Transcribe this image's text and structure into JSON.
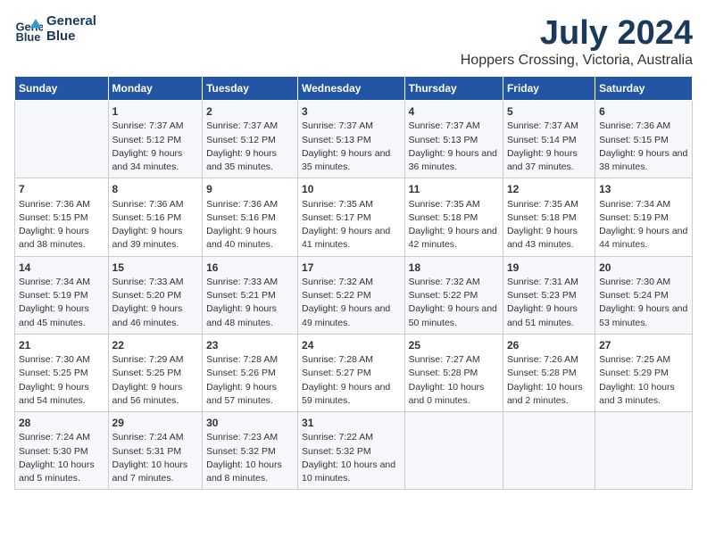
{
  "logo": {
    "line1": "General",
    "line2": "Blue"
  },
  "title": "July 2024",
  "location": "Hoppers Crossing, Victoria, Australia",
  "days_of_week": [
    "Sunday",
    "Monday",
    "Tuesday",
    "Wednesday",
    "Thursday",
    "Friday",
    "Saturday"
  ],
  "weeks": [
    [
      {
        "day": "",
        "sunrise": "",
        "sunset": "",
        "daylight": ""
      },
      {
        "day": "1",
        "sunrise": "Sunrise: 7:37 AM",
        "sunset": "Sunset: 5:12 PM",
        "daylight": "Daylight: 9 hours and 34 minutes."
      },
      {
        "day": "2",
        "sunrise": "Sunrise: 7:37 AM",
        "sunset": "Sunset: 5:12 PM",
        "daylight": "Daylight: 9 hours and 35 minutes."
      },
      {
        "day": "3",
        "sunrise": "Sunrise: 7:37 AM",
        "sunset": "Sunset: 5:13 PM",
        "daylight": "Daylight: 9 hours and 35 minutes."
      },
      {
        "day": "4",
        "sunrise": "Sunrise: 7:37 AM",
        "sunset": "Sunset: 5:13 PM",
        "daylight": "Daylight: 9 hours and 36 minutes."
      },
      {
        "day": "5",
        "sunrise": "Sunrise: 7:37 AM",
        "sunset": "Sunset: 5:14 PM",
        "daylight": "Daylight: 9 hours and 37 minutes."
      },
      {
        "day": "6",
        "sunrise": "Sunrise: 7:36 AM",
        "sunset": "Sunset: 5:15 PM",
        "daylight": "Daylight: 9 hours and 38 minutes."
      }
    ],
    [
      {
        "day": "7",
        "sunrise": "Sunrise: 7:36 AM",
        "sunset": "Sunset: 5:15 PM",
        "daylight": "Daylight: 9 hours and 38 minutes."
      },
      {
        "day": "8",
        "sunrise": "Sunrise: 7:36 AM",
        "sunset": "Sunset: 5:16 PM",
        "daylight": "Daylight: 9 hours and 39 minutes."
      },
      {
        "day": "9",
        "sunrise": "Sunrise: 7:36 AM",
        "sunset": "Sunset: 5:16 PM",
        "daylight": "Daylight: 9 hours and 40 minutes."
      },
      {
        "day": "10",
        "sunrise": "Sunrise: 7:35 AM",
        "sunset": "Sunset: 5:17 PM",
        "daylight": "Daylight: 9 hours and 41 minutes."
      },
      {
        "day": "11",
        "sunrise": "Sunrise: 7:35 AM",
        "sunset": "Sunset: 5:18 PM",
        "daylight": "Daylight: 9 hours and 42 minutes."
      },
      {
        "day": "12",
        "sunrise": "Sunrise: 7:35 AM",
        "sunset": "Sunset: 5:18 PM",
        "daylight": "Daylight: 9 hours and 43 minutes."
      },
      {
        "day": "13",
        "sunrise": "Sunrise: 7:34 AM",
        "sunset": "Sunset: 5:19 PM",
        "daylight": "Daylight: 9 hours and 44 minutes."
      }
    ],
    [
      {
        "day": "14",
        "sunrise": "Sunrise: 7:34 AM",
        "sunset": "Sunset: 5:19 PM",
        "daylight": "Daylight: 9 hours and 45 minutes."
      },
      {
        "day": "15",
        "sunrise": "Sunrise: 7:33 AM",
        "sunset": "Sunset: 5:20 PM",
        "daylight": "Daylight: 9 hours and 46 minutes."
      },
      {
        "day": "16",
        "sunrise": "Sunrise: 7:33 AM",
        "sunset": "Sunset: 5:21 PM",
        "daylight": "Daylight: 9 hours and 48 minutes."
      },
      {
        "day": "17",
        "sunrise": "Sunrise: 7:32 AM",
        "sunset": "Sunset: 5:22 PM",
        "daylight": "Daylight: 9 hours and 49 minutes."
      },
      {
        "day": "18",
        "sunrise": "Sunrise: 7:32 AM",
        "sunset": "Sunset: 5:22 PM",
        "daylight": "Daylight: 9 hours and 50 minutes."
      },
      {
        "day": "19",
        "sunrise": "Sunrise: 7:31 AM",
        "sunset": "Sunset: 5:23 PM",
        "daylight": "Daylight: 9 hours and 51 minutes."
      },
      {
        "day": "20",
        "sunrise": "Sunrise: 7:30 AM",
        "sunset": "Sunset: 5:24 PM",
        "daylight": "Daylight: 9 hours and 53 minutes."
      }
    ],
    [
      {
        "day": "21",
        "sunrise": "Sunrise: 7:30 AM",
        "sunset": "Sunset: 5:25 PM",
        "daylight": "Daylight: 9 hours and 54 minutes."
      },
      {
        "day": "22",
        "sunrise": "Sunrise: 7:29 AM",
        "sunset": "Sunset: 5:25 PM",
        "daylight": "Daylight: 9 hours and 56 minutes."
      },
      {
        "day": "23",
        "sunrise": "Sunrise: 7:28 AM",
        "sunset": "Sunset: 5:26 PM",
        "daylight": "Daylight: 9 hours and 57 minutes."
      },
      {
        "day": "24",
        "sunrise": "Sunrise: 7:28 AM",
        "sunset": "Sunset: 5:27 PM",
        "daylight": "Daylight: 9 hours and 59 minutes."
      },
      {
        "day": "25",
        "sunrise": "Sunrise: 7:27 AM",
        "sunset": "Sunset: 5:28 PM",
        "daylight": "Daylight: 10 hours and 0 minutes."
      },
      {
        "day": "26",
        "sunrise": "Sunrise: 7:26 AM",
        "sunset": "Sunset: 5:28 PM",
        "daylight": "Daylight: 10 hours and 2 minutes."
      },
      {
        "day": "27",
        "sunrise": "Sunrise: 7:25 AM",
        "sunset": "Sunset: 5:29 PM",
        "daylight": "Daylight: 10 hours and 3 minutes."
      }
    ],
    [
      {
        "day": "28",
        "sunrise": "Sunrise: 7:24 AM",
        "sunset": "Sunset: 5:30 PM",
        "daylight": "Daylight: 10 hours and 5 minutes."
      },
      {
        "day": "29",
        "sunrise": "Sunrise: 7:24 AM",
        "sunset": "Sunset: 5:31 PM",
        "daylight": "Daylight: 10 hours and 7 minutes."
      },
      {
        "day": "30",
        "sunrise": "Sunrise: 7:23 AM",
        "sunset": "Sunset: 5:32 PM",
        "daylight": "Daylight: 10 hours and 8 minutes."
      },
      {
        "day": "31",
        "sunrise": "Sunrise: 7:22 AM",
        "sunset": "Sunset: 5:32 PM",
        "daylight": "Daylight: 10 hours and 10 minutes."
      },
      {
        "day": "",
        "sunrise": "",
        "sunset": "",
        "daylight": ""
      },
      {
        "day": "",
        "sunrise": "",
        "sunset": "",
        "daylight": ""
      },
      {
        "day": "",
        "sunrise": "",
        "sunset": "",
        "daylight": ""
      }
    ]
  ]
}
